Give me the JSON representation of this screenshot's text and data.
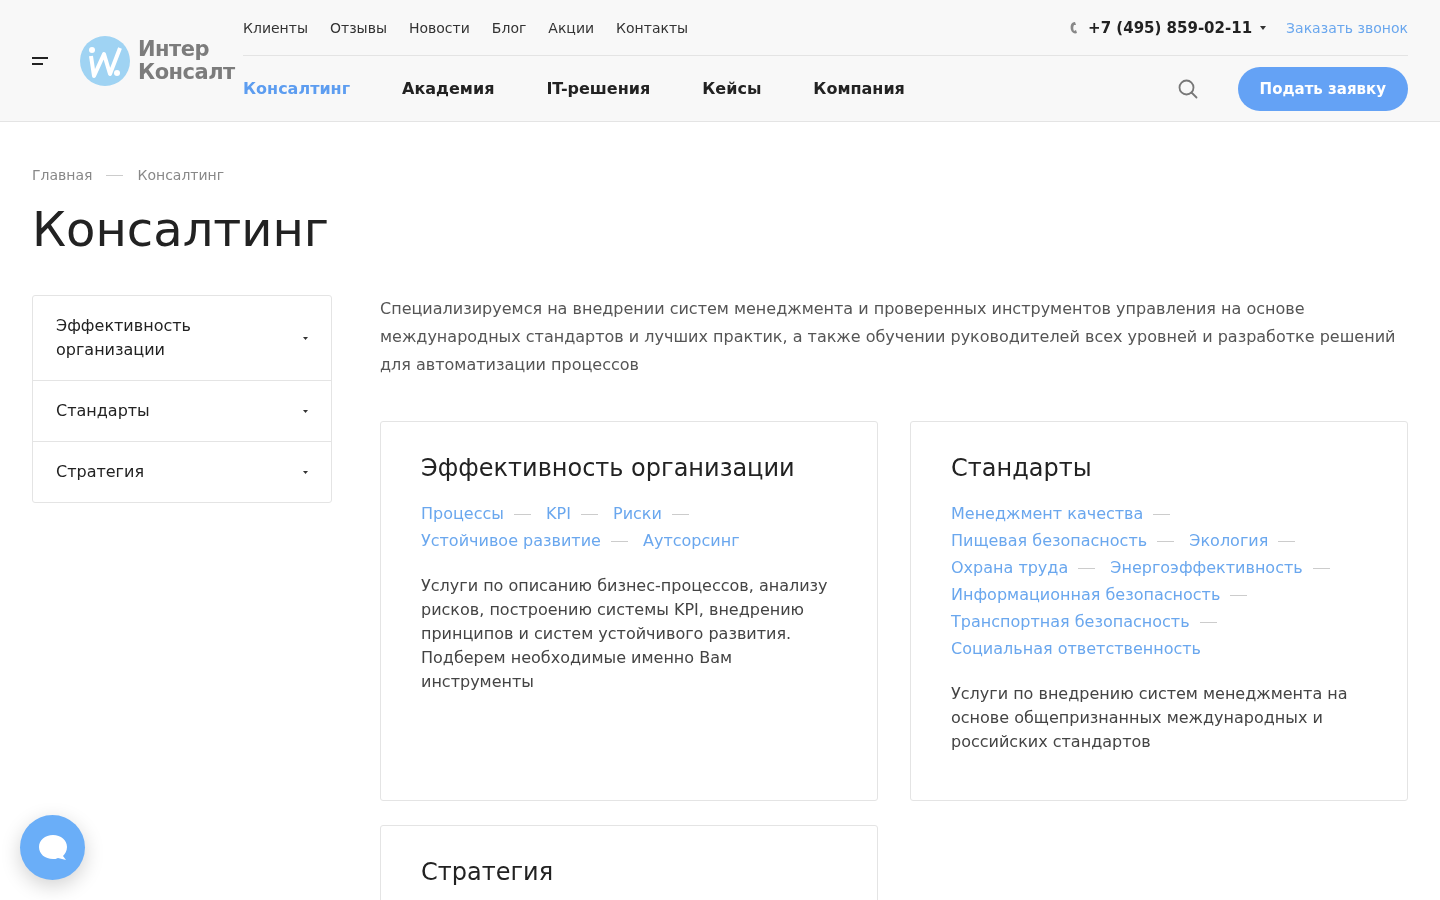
{
  "logo": {
    "lines": [
      "Интер",
      "Консалт"
    ]
  },
  "top_links": [
    "Клиенты",
    "Отзывы",
    "Новости",
    "Блог",
    "Акции",
    "Контакты"
  ],
  "phone": "+7 (495) 859-02-11",
  "callback_link": "Заказать звонок",
  "main_nav": [
    {
      "label": "Консалтинг",
      "selected": true
    },
    {
      "label": "Академия",
      "selected": false
    },
    {
      "label": "IT-решения",
      "selected": false
    },
    {
      "label": "Кейсы",
      "selected": false
    },
    {
      "label": "Компания",
      "selected": false
    }
  ],
  "apply_button": "Подать заявку",
  "breadcrumbs": [
    "Главная",
    "Консалтинг"
  ],
  "page_title": "Консалтинг",
  "sidebar": {
    "items": [
      "Эффективность организации",
      "Стандарты",
      "Стратегия"
    ]
  },
  "intro": "Специализируемся на внедрении систем менеджмента и проверенных инструментов управления на основе международных стандартов и лучших практик, а также обучении руководителей всех уровней и разработке решений для автоматизации процессов",
  "cards": [
    {
      "title": "Эффективность организации",
      "tags": [
        "Процессы",
        "KPI",
        "Риски",
        "Устойчивое развитие",
        "Аутсорсинг"
      ],
      "description": "Услуги по описанию бизнес-процессов, анализу рисков, построению системы KPI, внедрению принципов и систем устойчивого развития. Подберем необходимые именно Вам инструменты"
    },
    {
      "title": "Стандарты",
      "tags": [
        "Менеджмент качества",
        "Пищевая безопасность",
        "Экология",
        "Охрана труда",
        "Энергоэффективность",
        "Информационная безопасность",
        "Транспортная безопасность",
        "Социальная ответственность"
      ],
      "description": "Услуги по внедрению систем менеджмента на основе общепризнанных международных и российских стандартов"
    },
    {
      "title": "Стратегия"
    }
  ]
}
